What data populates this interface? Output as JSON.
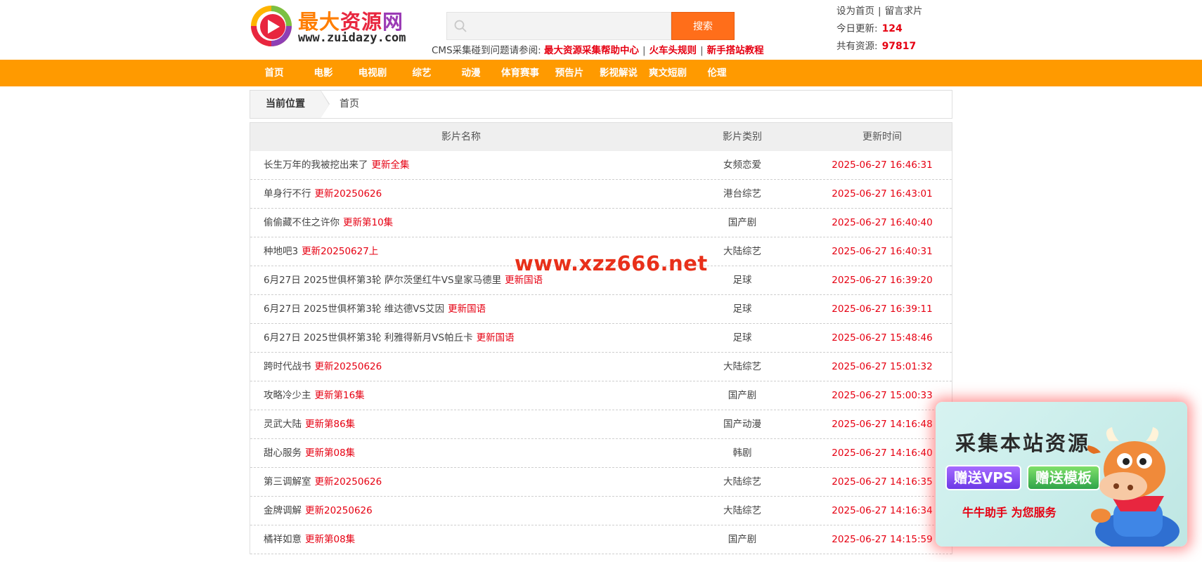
{
  "logo": {
    "name_part1": "最大",
    "name_part2": "资源",
    "name_part3": "网",
    "url": "www.zuidazy.com"
  },
  "search": {
    "button_label": "搜索",
    "value": ""
  },
  "notice": {
    "prefix": "CMS采集碰到问题请参阅:",
    "links": [
      "最大资源采集帮助中心",
      "火车头规则",
      "新手搭站教程"
    ],
    "separator": "|"
  },
  "toplinks": {
    "set_home": "设为首页",
    "request": "留言求片",
    "separator": "|",
    "today_label": "今日更新:",
    "today_count": "124",
    "total_label": "共有资源:",
    "total_count": "97817"
  },
  "nav": {
    "items": [
      "首页",
      "电影",
      "电视剧",
      "综艺",
      "动漫",
      "体育赛事",
      "预告片",
      "影视解说",
      "爽文短剧",
      "伦理"
    ]
  },
  "breadcrumb": {
    "label": "当前位置",
    "current": "首页"
  },
  "table": {
    "headers": [
      "影片名称",
      "影片类别",
      "更新时间"
    ],
    "rows": [
      {
        "name": "长生万年的我被挖出来了",
        "note": "更新全集",
        "category": "女频恋爱",
        "time": "2025-06-27 16:46:31"
      },
      {
        "name": "单身行不行",
        "note": "更新20250626",
        "category": "港台综艺",
        "time": "2025-06-27 16:43:01"
      },
      {
        "name": "偷偷藏不住之许你",
        "note": "更新第10集",
        "category": "国产剧",
        "time": "2025-06-27 16:40:40"
      },
      {
        "name": "种地吧3",
        "note": "更新20250627上",
        "category": "大陆综艺",
        "time": "2025-06-27 16:40:31"
      },
      {
        "name": "6月27日 2025世俱杯第3轮 萨尔茨堡红牛VS皇家马德里",
        "note": "更新国语",
        "category": "足球",
        "time": "2025-06-27 16:39:20"
      },
      {
        "name": "6月27日 2025世俱杯第3轮 维达德VS艾因",
        "note": "更新国语",
        "category": "足球",
        "time": "2025-06-27 16:39:11"
      },
      {
        "name": "6月27日 2025世俱杯第3轮 利雅得新月VS帕丘卡",
        "note": "更新国语",
        "category": "足球",
        "time": "2025-06-27 15:48:46"
      },
      {
        "name": "跨时代战书",
        "note": "更新20250626",
        "category": "大陆综艺",
        "time": "2025-06-27 15:01:32"
      },
      {
        "name": "攻略冷少主",
        "note": "更新第16集",
        "category": "国产剧",
        "time": "2025-06-27 15:00:33"
      },
      {
        "name": "灵武大陆",
        "note": "更新第86集",
        "category": "国产动漫",
        "time": "2025-06-27 14:16:48"
      },
      {
        "name": "甜心服务",
        "note": "更新第08集",
        "category": "韩剧",
        "time": "2025-06-27 14:16:40"
      },
      {
        "name": "第三调解室",
        "note": "更新20250626",
        "category": "大陆综艺",
        "time": "2025-06-27 14:16:35"
      },
      {
        "name": "金牌调解",
        "note": "更新20250626",
        "category": "大陆综艺",
        "time": "2025-06-27 14:16:34"
      },
      {
        "name": "橘祥如意",
        "note": "更新第08集",
        "category": "国产剧",
        "time": "2025-06-27 14:15:59"
      }
    ]
  },
  "watermark": "www.xzz666.net",
  "ad": {
    "title": "采集本站资源",
    "chip_vps": "赠送VPS",
    "chip_template": "赠送模板",
    "subtitle": "牛牛助手 为您服务"
  }
}
